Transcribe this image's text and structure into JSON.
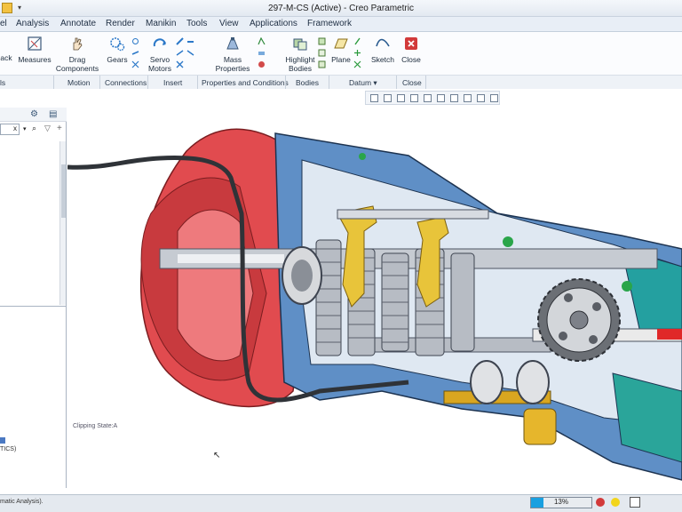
{
  "window": {
    "title": "297-M-CS (Active) - Creo Parametric"
  },
  "menu": {
    "tabs": [
      "el",
      "Analysis",
      "Annotate",
      "Render",
      "Manikin",
      "Tools",
      "View",
      "Applications",
      "Framework"
    ]
  },
  "ribbon": {
    "back": "ack",
    "measures": "Measures",
    "drag": "Drag Components",
    "gears": "Gears",
    "servo": "Servo Motors",
    "mass": "Mass Properties",
    "highlight": "Highlight Bodies",
    "plane": "Plane",
    "sketch": "Sketch",
    "close": "Close"
  },
  "groups": {
    "first": "ls",
    "motion": "Motion",
    "connections": "Connections",
    "insert": "Insert",
    "props": "Properties and Conditions",
    "bodies": "Bodies",
    "datum": "Datum",
    "close": "Close"
  },
  "panel": {
    "input_value": "x",
    "tree_text": "TICS)"
  },
  "canvas": {
    "clipping_label": "Clipping State:A"
  },
  "status": {
    "message": "matic Analysis).",
    "zoom": "13%"
  },
  "colors": {
    "housing_red": "#e14b4f",
    "housing_blue": "#5f8fc6",
    "gear_gray": "#b7bcc4",
    "fork_yellow": "#e8c43a",
    "accent_green": "#2aa54a"
  }
}
